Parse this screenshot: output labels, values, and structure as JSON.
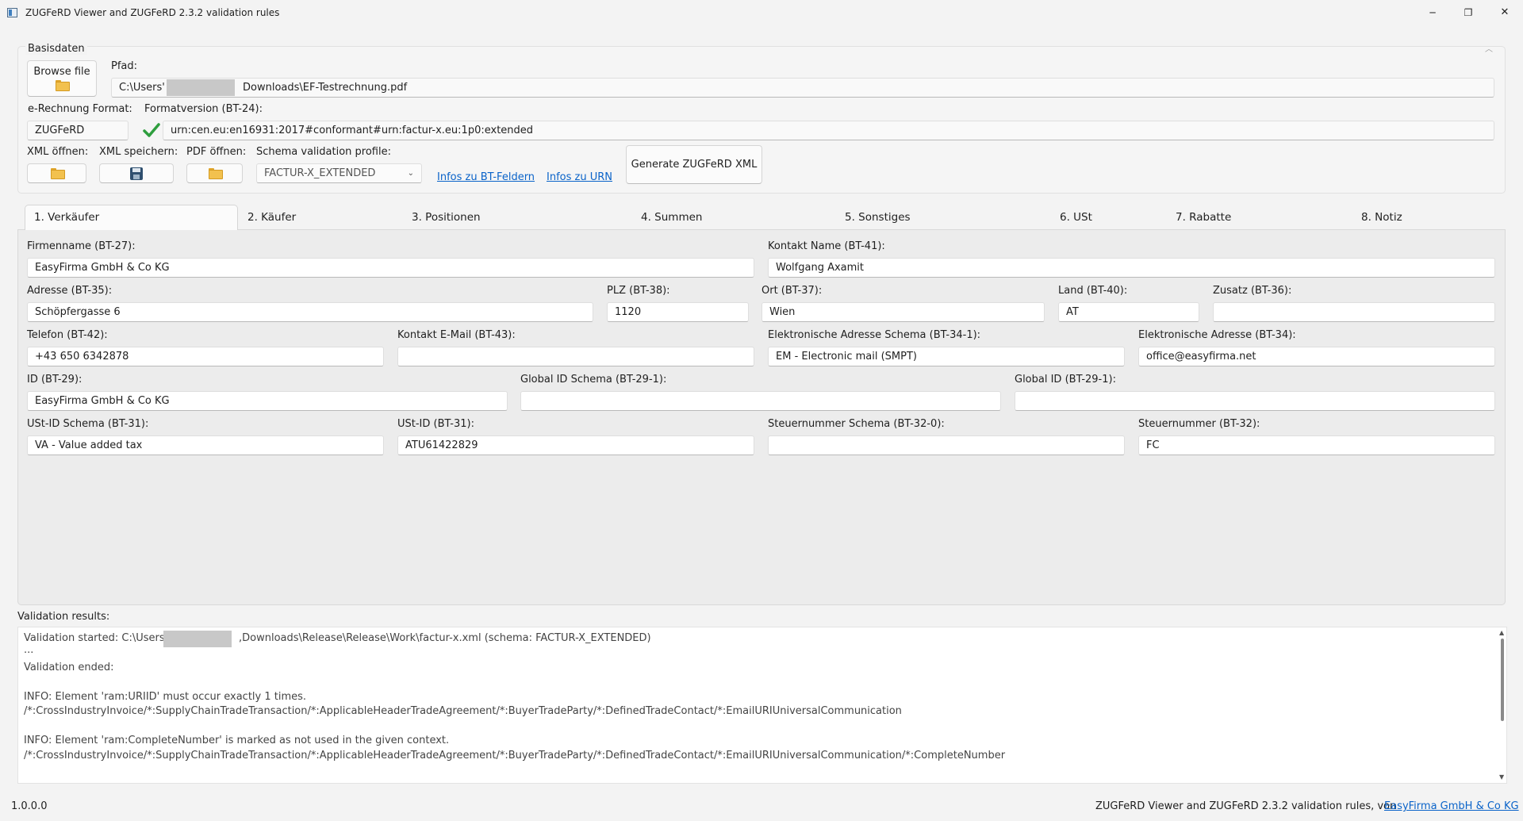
{
  "window": {
    "title": "ZUGFeRD Viewer and ZUGFeRD 2.3.2 validation rules",
    "minimize": "─",
    "restore": "❐",
    "close": "✕"
  },
  "basis": {
    "group_title": "Basisdaten",
    "browse_label": "Browse file",
    "pfad_label": "Pfad:",
    "pfad_start": "C:\\Users'",
    "pfad_end": "Downloads\\EF-Testrechnung.pdf",
    "format_label": "e-Rechnung Format:",
    "format_value": "ZUGFeRD",
    "formatversion_label": "Formatversion (BT-24):",
    "formatversion_value": "urn:cen.eu:en16931:2017#conformant#urn:factur-x.eu:1p0:extended",
    "xml_open_label": "XML öffnen:",
    "xml_save_label": "XML speichern:",
    "pdf_open_label": "PDF öffnen:",
    "schema_label": "Schema validation profile:",
    "schema_value": "FACTUR-X_EXTENDED",
    "link_bt": "Infos zu BT-Feldern",
    "link_urn": "Infos zu URN",
    "generate_label": "Generate ZUGFeRD XML"
  },
  "tabs": [
    {
      "label": "1. Verkäufer"
    },
    {
      "label": "2. Käufer"
    },
    {
      "label": "3. Positionen"
    },
    {
      "label": "4. Summen"
    },
    {
      "label": "5. Sonstiges"
    },
    {
      "label": "6. USt"
    },
    {
      "label": "7. Rabatte"
    },
    {
      "label": "8. Notiz"
    }
  ],
  "seller": {
    "firmenname_label": "Firmenname (BT-27):",
    "firmenname": "EasyFirma GmbH & Co KG",
    "kontakt_name_label": "Kontakt Name (BT-41):",
    "kontakt_name": "Wolfgang Axamit",
    "adresse_label": "Adresse (BT-35):",
    "adresse": "Schöpfergasse 6",
    "plz_label": "PLZ (BT-38):",
    "plz": "1120",
    "ort_label": "Ort (BT-37):",
    "ort": "Wien",
    "land_label": "Land (BT-40):",
    "land": "AT",
    "zusatz_label": "Zusatz (BT-36):",
    "zusatz": "",
    "telefon_label": "Telefon (BT-42):",
    "telefon": "+43 650 6342878",
    "kontakt_email_label": "Kontakt E-Mail (BT-43):",
    "kontakt_email": "",
    "el_adresse_schema_label": "Elektronische Adresse Schema (BT-34-1):",
    "el_adresse_schema": "EM - Electronic mail (SMPT)",
    "el_adresse_label": "Elektronische Adresse (BT-34):",
    "el_adresse": "office@easyfirma.net",
    "id_label": "ID (BT-29):",
    "id": "EasyFirma GmbH & Co KG",
    "global_id_schema_label": "Global ID Schema (BT-29-1):",
    "global_id_schema": "",
    "global_id_label": "Global ID (BT-29-1):",
    "global_id": "",
    "ust_id_schema_label": "USt-ID Schema (BT-31):",
    "ust_id_schema": "VA - Value added tax",
    "ust_id_label": "USt-ID (BT-31):",
    "ust_id": "ATU61422829",
    "steuernummer_schema_label": "Steuernummer Schema (BT-32-0):",
    "steuernummer_schema": "",
    "steuernummer_label": "Steuernummer (BT-32):",
    "steuernummer": "FC"
  },
  "validation": {
    "title": "Validation results:",
    "line1_start": "Validation started: C:\\Users",
    "line1_end": ",Downloads\\Release\\Release\\Work\\factur-x.xml (schema: FACTUR-X_EXTENDED)",
    "line2": "...",
    "line3": "Validation ended:",
    "info1": "INFO: Element 'ram:URIID' must occur exactly 1 times.",
    "path1": "/*:CrossIndustryInvoice/*:SupplyChainTradeTransaction/*:ApplicableHeaderTradeAgreement/*:BuyerTradeParty/*:DefinedTradeContact/*:EmailURIUniversalCommunication",
    "info2": "INFO: Element 'ram:CompleteNumber' is marked as not used in the given context.",
    "path2": "/*:CrossIndustryInvoice/*:SupplyChainTradeTransaction/*:ApplicableHeaderTradeAgreement/*:BuyerTradeParty/*:DefinedTradeContact/*:EmailURIUniversalCommunication/*:CompleteNumber"
  },
  "status": {
    "version": "1.0.0.0",
    "credit": "ZUGFeRD Viewer and ZUGFeRD 2.3.2 validation rules, von",
    "credit_link": "EasyFirma GmbH & Co KG"
  }
}
